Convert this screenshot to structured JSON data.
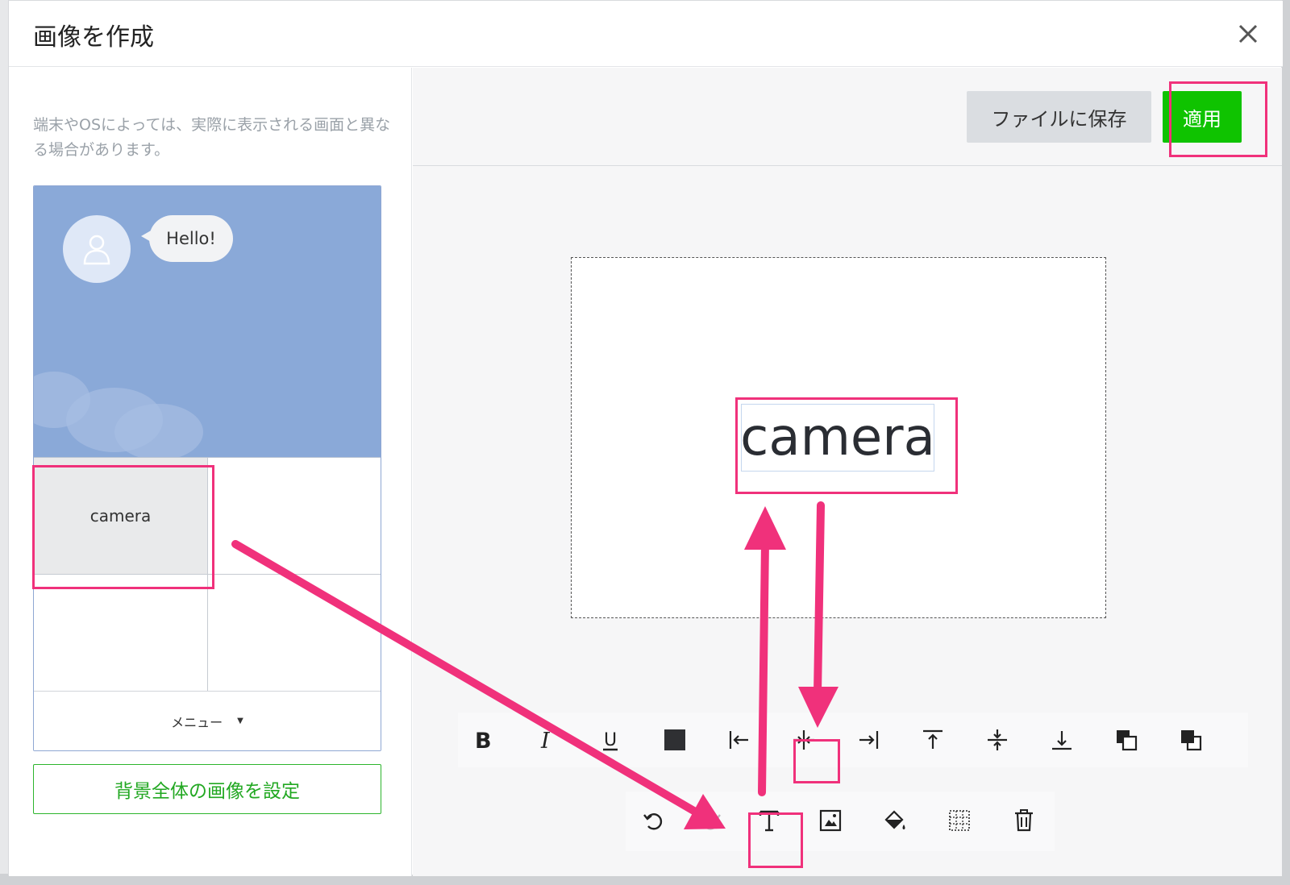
{
  "dialog": {
    "title": "画像を作成"
  },
  "left": {
    "notice": "端末やOSによっては、実際に表示される画面と異なる場合があります。",
    "chat": {
      "greeting": "Hello!"
    },
    "rich_menu": {
      "cells": [
        "camera",
        "",
        "",
        ""
      ],
      "menu_label": "メニュー"
    },
    "set_background_label": "背景全体の画像を設定"
  },
  "right": {
    "save_file_label": "ファイルに保存",
    "apply_label": "適用",
    "canvas_text": "camera"
  },
  "toolbar": {
    "format_tools": [
      "bold-icon",
      "italic-icon",
      "underline-icon",
      "text-color-icon",
      "align-left-icon",
      "align-center-icon",
      "align-right-icon",
      "align-top-icon",
      "align-middle-icon",
      "align-bottom-icon",
      "bring-front-icon",
      "send-back-icon"
    ],
    "action_tools": [
      "undo-icon",
      "redo-icon",
      "add-text-icon",
      "add-image-icon",
      "fill-color-icon",
      "grid-icon",
      "delete-icon"
    ]
  },
  "colors": {
    "accent_green": "#0fc300",
    "highlight_pink": "#f0317b",
    "preview_bg": "#8aa9d8"
  }
}
